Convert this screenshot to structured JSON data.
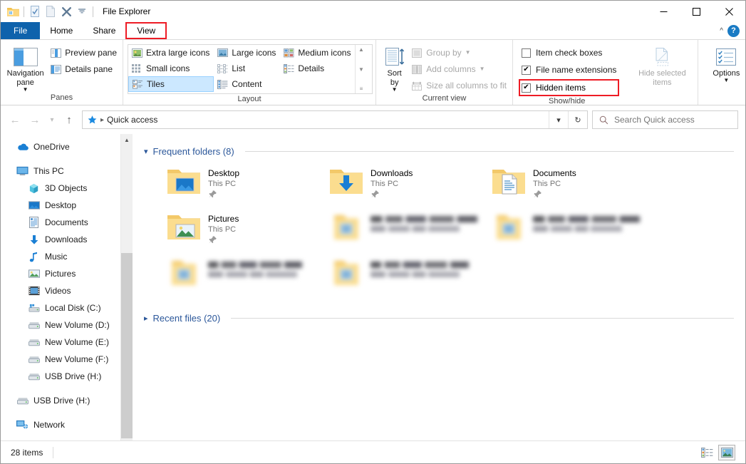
{
  "window": {
    "title": "File Explorer",
    "quick_access_toolbar": [
      {
        "name": "explorer-icon",
        "label": "File Explorer"
      },
      {
        "name": "properties-icon",
        "label": "Properties"
      },
      {
        "name": "new-folder-icon",
        "label": "New folder"
      },
      {
        "name": "delete-icon",
        "label": "Delete"
      },
      {
        "name": "customize-qat-icon",
        "label": "Customize Quick Access Toolbar"
      }
    ],
    "controls": {
      "minimize": "Minimize",
      "maximize": "Maximize",
      "close": "Close"
    }
  },
  "tabs": {
    "file": "File",
    "items": [
      "Home",
      "Share",
      "View"
    ],
    "active": "View",
    "collapse_ribbon": "Collapse the Ribbon",
    "help": "?"
  },
  "ribbon": {
    "groups": [
      {
        "label": "Panes",
        "big_button": {
          "label_line1": "Navigation",
          "label_line2": "pane",
          "has_caret": true
        },
        "small_items": [
          {
            "label": "Preview pane",
            "icon": "preview-pane-icon"
          },
          {
            "label": "Details pane",
            "icon": "details-pane-icon"
          }
        ]
      },
      {
        "label": "Layout",
        "gallery": [
          {
            "label": "Extra large icons",
            "selected": false
          },
          {
            "label": "Small icons",
            "selected": false
          },
          {
            "label": "Tiles",
            "selected": true
          },
          {
            "label": "Large icons",
            "selected": false
          },
          {
            "label": "List",
            "selected": false
          },
          {
            "label": "Content",
            "selected": false
          },
          {
            "label": "Medium icons",
            "selected": false
          },
          {
            "label": "Details",
            "selected": false
          }
        ]
      },
      {
        "label": "Current view",
        "big_button": {
          "label_line1": "Sort",
          "label_line2": "by",
          "has_caret": true
        },
        "small_items": [
          {
            "label": "Group by",
            "icon": "group-by-icon",
            "disabled": true,
            "caret": true
          },
          {
            "label": "Add columns",
            "icon": "add-columns-icon",
            "disabled": true,
            "caret": true
          },
          {
            "label": "Size all columns to fit",
            "icon": "size-columns-icon",
            "disabled": true,
            "caret": false
          }
        ]
      },
      {
        "label": "Show/hide",
        "checkboxes": [
          {
            "label": "Item check boxes",
            "checked": false,
            "highlighted": false
          },
          {
            "label": "File name extensions",
            "checked": true,
            "highlighted": false
          },
          {
            "label": "Hidden items",
            "checked": true,
            "highlighted": true
          }
        ],
        "hide_selected": {
          "label_line1": "Hide selected",
          "label_line2": "items"
        },
        "options": {
          "label": "Options",
          "has_caret": true
        }
      }
    ]
  },
  "address_bar": {
    "back": "Back",
    "forward": "Forward",
    "recent": "Recent locations",
    "up": "Up",
    "crumb_icon": "quick-access-star-icon",
    "crumb": "Quick access",
    "dropdown": "Previous locations",
    "refresh": "Refresh",
    "search_placeholder": "Search Quick access"
  },
  "navigation_pane": {
    "items": [
      {
        "label": "OneDrive",
        "icon": "onedrive-icon",
        "level": 0,
        "gap_before": false
      },
      {
        "label": "This PC",
        "icon": "this-pc-icon",
        "level": 0,
        "gap_before": true
      },
      {
        "label": "3D Objects",
        "icon": "3d-objects-icon",
        "level": 1,
        "gap_before": false
      },
      {
        "label": "Desktop",
        "icon": "desktop-icon",
        "level": 1,
        "gap_before": false
      },
      {
        "label": "Documents",
        "icon": "documents-icon",
        "level": 1,
        "gap_before": false
      },
      {
        "label": "Downloads",
        "icon": "downloads-icon",
        "level": 1,
        "gap_before": false
      },
      {
        "label": "Music",
        "icon": "music-icon",
        "level": 1,
        "gap_before": false
      },
      {
        "label": "Pictures",
        "icon": "pictures-icon",
        "level": 1,
        "gap_before": false
      },
      {
        "label": "Videos",
        "icon": "videos-icon",
        "level": 1,
        "gap_before": false
      },
      {
        "label": "Local Disk (C:)",
        "icon": "local-disk-icon",
        "level": 1,
        "gap_before": false
      },
      {
        "label": "New Volume (D:)",
        "icon": "drive-icon",
        "level": 1,
        "gap_before": false
      },
      {
        "label": "New Volume (E:)",
        "icon": "drive-icon",
        "level": 1,
        "gap_before": false
      },
      {
        "label": "New Volume (F:)",
        "icon": "drive-icon",
        "level": 1,
        "gap_before": false
      },
      {
        "label": "USB Drive (H:)",
        "icon": "drive-icon",
        "level": 1,
        "gap_before": false
      },
      {
        "label": "USB Drive (H:)",
        "icon": "drive-icon",
        "level": 0,
        "gap_before": true
      },
      {
        "label": "Network",
        "icon": "network-icon",
        "level": 0,
        "gap_before": true
      }
    ]
  },
  "content": {
    "sections": [
      {
        "title": "Frequent folders (8)",
        "expanded": true
      },
      {
        "title": "Recent files (20)",
        "expanded": false
      }
    ],
    "frequent_folders": [
      {
        "name": "Desktop",
        "location": "This PC",
        "icon": "folder-desktop-icon",
        "pinned": true,
        "redacted": false
      },
      {
        "name": "Downloads",
        "location": "This PC",
        "icon": "folder-downloads-icon",
        "pinned": true,
        "redacted": false
      },
      {
        "name": "Documents",
        "location": "This PC",
        "icon": "folder-documents-icon",
        "pinned": true,
        "redacted": false
      },
      {
        "name": "Pictures",
        "location": "This PC",
        "icon": "folder-pictures-icon",
        "pinned": true,
        "redacted": false
      },
      {
        "name": "",
        "location": "",
        "icon": "folder-icon",
        "pinned": false,
        "redacted": true
      },
      {
        "name": "",
        "location": "",
        "icon": "folder-icon",
        "pinned": false,
        "redacted": true
      },
      {
        "name": "",
        "location": "",
        "icon": "folder-icon",
        "pinned": false,
        "redacted": true
      },
      {
        "name": "",
        "location": "",
        "icon": "folder-icon",
        "pinned": false,
        "redacted": true
      }
    ]
  },
  "status_bar": {
    "item_count": "28 items",
    "view_buttons": [
      {
        "name": "details-view-button",
        "label": "Details view",
        "active": false
      },
      {
        "name": "large-icons-view-button",
        "label": "Large icons view",
        "active": true
      }
    ]
  },
  "colors": {
    "accent_blue": "#0e62ac",
    "section_blue": "#2b579a",
    "highlight_red": "#ee1c25",
    "selection_blue": "#cce8ff"
  }
}
